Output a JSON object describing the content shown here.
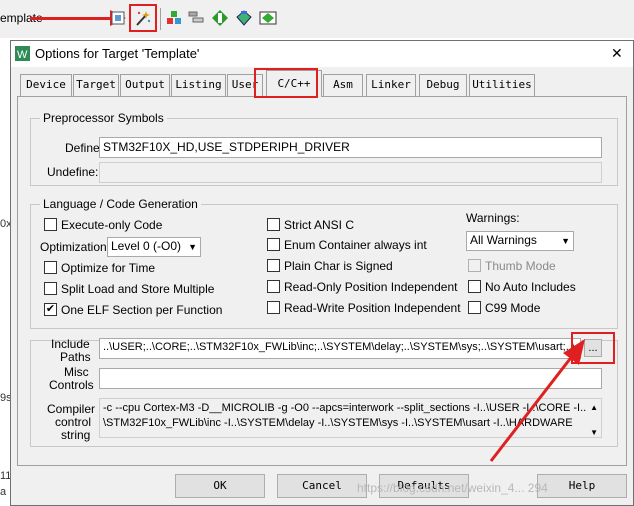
{
  "ide": {
    "target_name": "emplate",
    "side_texts": [
      "0x",
      "9s",
      "11",
      "a"
    ]
  },
  "dialog": {
    "title": "Options for Target 'Template'",
    "close_glyph": "✕",
    "tabs": [
      "Device",
      "Target",
      "Output",
      "Listing",
      "User",
      "C/C++",
      "Asm",
      "Linker",
      "Debug",
      "Utilities"
    ],
    "active_tab": "C/C++",
    "preprocessor": {
      "group_title": "Preprocessor Symbols",
      "define_label": "Define:",
      "define_value": "STM32F10X_HD,USE_STDPERIPH_DRIVER",
      "undefine_label": "Undefine:",
      "undefine_value": ""
    },
    "language": {
      "group_title": "Language / Code Generation",
      "execute_only": "Execute-only Code",
      "optimization_label": "Optimization:",
      "optimization_value": "Level 0 (-O0)",
      "optimize_time": "Optimize for Time",
      "split_load": "Split Load and Store Multiple",
      "one_elf": "One ELF Section per Function",
      "strict_ansi": "Strict ANSI C",
      "enum_container": "Enum Container always int",
      "plain_char": "Plain Char is Signed",
      "ro_pi": "Read-Only Position Independent",
      "rw_pi": "Read-Write Position Independent",
      "warnings_label": "Warnings:",
      "warnings_value": "All Warnings",
      "thumb_mode": "Thumb Mode",
      "no_auto_includes": "No Auto Includes",
      "c99_mode": "C99 Mode",
      "checkmark": "✔"
    },
    "include": {
      "include_label_1": "Include",
      "include_label_2": "Paths",
      "include_value": "..\\USER;..\\CORE;..\\STM32F10x_FWLib\\inc;..\\SYSTEM\\delay;..\\SYSTEM\\sys;..\\SYSTEM\\usart;..\\",
      "browse_label": "...",
      "misc_label_1": "Misc",
      "misc_label_2": "Controls",
      "misc_value": "",
      "compiler_label_1": "Compiler",
      "compiler_label_2": "control",
      "compiler_label_3": "string",
      "compiler_line_1": "-c --cpu Cortex-M3 -D__MICROLIB -g -O0 --apcs=interwork --split_sections -I..\\USER -I..\\CORE -I..",
      "compiler_line_2": "\\STM32F10x_FWLib\\inc -I..\\SYSTEM\\delay -I..\\SYSTEM\\sys -I..\\SYSTEM\\usart -I..\\HARDWARE"
    },
    "buttons": {
      "ok": "OK",
      "cancel": "Cancel",
      "defaults": "Defaults",
      "help": "Help"
    },
    "watermark": "https://blog.csdn.net/weixin_4... 294"
  }
}
